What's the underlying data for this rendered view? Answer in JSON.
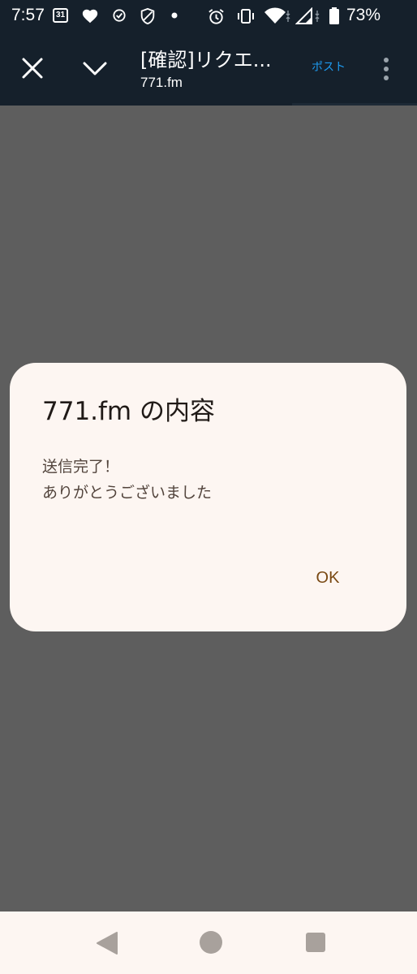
{
  "status_bar": {
    "time": "7:57",
    "calendar_day": "31",
    "battery_percent": "73%"
  },
  "app_bar": {
    "title": "[確認]リクエ...",
    "url": "771.fm",
    "post_label": "ポスト"
  },
  "dialog": {
    "title": "771.fm の内容",
    "message": "送信完了！\nありがとうございました",
    "ok_label": "OK"
  },
  "colors": {
    "app_bar_bg": "#15202b",
    "scrim_bg": "#5e5e5e",
    "dialog_bg": "#fdf6f2",
    "post_link": "#1d9bf0",
    "ok_button": "#7a4a14"
  }
}
